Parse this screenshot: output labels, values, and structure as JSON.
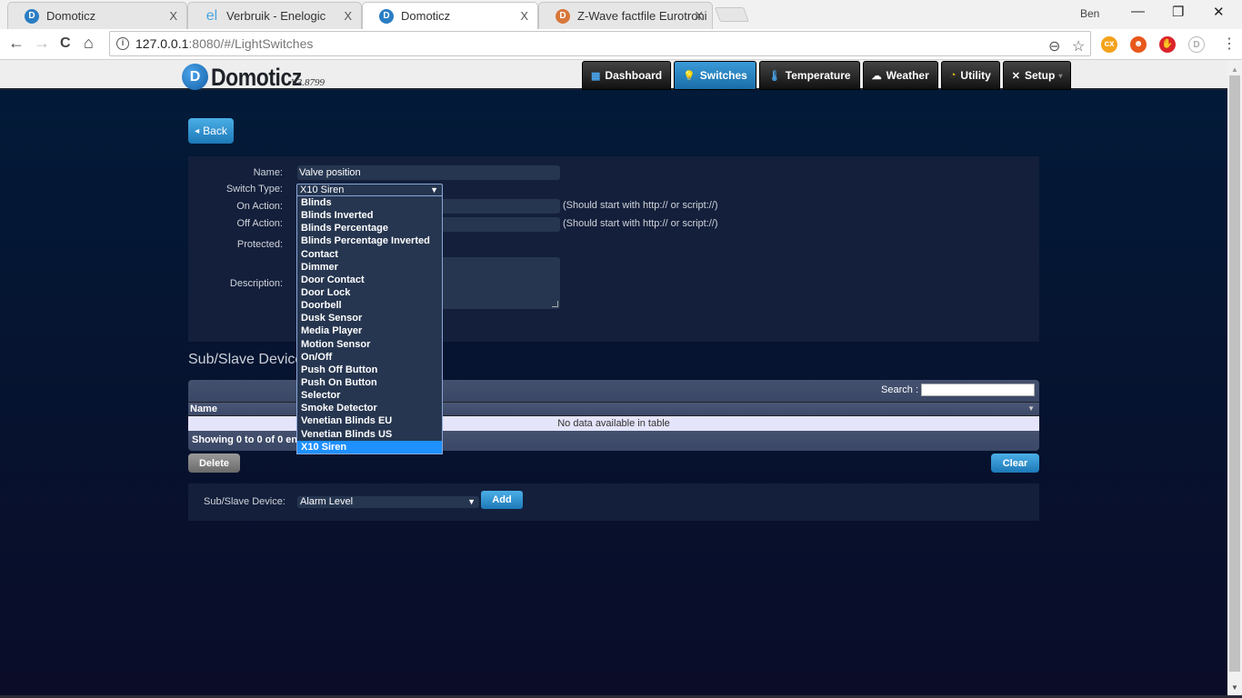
{
  "browser": {
    "tabs": [
      {
        "title": "Domoticz",
        "favicon": "domoticz-icon",
        "active": false
      },
      {
        "title": "Verbruik - Enelogic",
        "favicon": "enelogic-icon",
        "active": false
      },
      {
        "title": "Domoticz",
        "favicon": "domoticz-icon",
        "active": true
      },
      {
        "title": "Z-Wave factfile Eurotroni",
        "favicon": "zwave-icon",
        "active": false
      }
    ],
    "tab_close_glyph": "X",
    "user": "Ben",
    "window_controls": {
      "minimize": "—",
      "restore": "❐",
      "close": "✕"
    },
    "nav": {
      "back": "←",
      "forward": "→",
      "reload": "C",
      "home": "⌂"
    },
    "url_host": "127.0.0.1",
    "url_rest": ":8080/#/LightSwitches",
    "info_glyph": "i",
    "zoom_glyph": "⊖",
    "star_glyph": "☆",
    "extensions": [
      {
        "name": "ext-orange",
        "glyph": "cx",
        "color": "#f4a21a"
      },
      {
        "name": "ext-fire",
        "glyph": "☻",
        "color": "#e8581c"
      },
      {
        "name": "ext-shield",
        "glyph": "✋",
        "color": "#d9252b"
      },
      {
        "name": "ext-d",
        "glyph": "D",
        "color": "#bbbbbb"
      }
    ],
    "menu_glyph": "⋮"
  },
  "app": {
    "logo_mark": "D",
    "logo_text": "Domoticz",
    "version": "V3.8799",
    "nav": [
      {
        "label": "Dashboard",
        "icon": "▦",
        "active": false
      },
      {
        "label": "Switches",
        "icon": "💡",
        "active": true
      },
      {
        "label": "Temperature",
        "icon": "🌡",
        "active": false
      },
      {
        "label": "Weather",
        "icon": "☁",
        "active": false
      },
      {
        "label": "Utility",
        "icon": "◔",
        "active": false
      },
      {
        "label": "Setup",
        "icon": "✕",
        "active": false,
        "caret": "▾"
      }
    ]
  },
  "page": {
    "back_label": "Back",
    "back_glyph": "◂",
    "form": {
      "name_label": "Name:",
      "name_value": "Valve position",
      "switch_type_label": "Switch Type:",
      "switch_type_value": "X10 Siren",
      "select_arrow": "▼",
      "on_action_label": "On Action:",
      "on_action_value": "",
      "off_action_label": "Off Action:",
      "off_action_value": "",
      "action_hint": "(Should start with http:// or script://)",
      "protected_label": "Protected:",
      "description_label": "Description:",
      "description_value": ""
    },
    "switch_type_options": [
      "Blinds",
      "Blinds Inverted",
      "Blinds Percentage",
      "Blinds Percentage Inverted",
      "Contact",
      "Dimmer",
      "Door Contact",
      "Door Lock",
      "Doorbell",
      "Dusk Sensor",
      "Media Player",
      "Motion Sensor",
      "On/Off",
      "Push Off Button",
      "Push On Button",
      "Selector",
      "Smoke Detector",
      "Venetian Blinds EU",
      "Venetian Blinds US",
      "X10 Siren"
    ],
    "switch_type_selected_index": 19,
    "sub_section_title": "Sub/Slave Devices",
    "table": {
      "search_label": "Search :",
      "search_value": "",
      "columns": [
        "Name"
      ],
      "sort_glyph": "▼",
      "empty_text": "No data available in table",
      "info_text": "Showing 0 to 0 of 0 entries"
    },
    "delete_label": "Delete",
    "clear_label": "Clear",
    "sub_device": {
      "label": "Sub/Slave Device:",
      "selected": "Alarm Level",
      "add_label": "Add"
    }
  },
  "colors": {
    "accent": "#1d79b8",
    "page_bg": "#021b39",
    "panel_bg": "#131f3b",
    "dropdown_selected": "#1e90ff"
  }
}
